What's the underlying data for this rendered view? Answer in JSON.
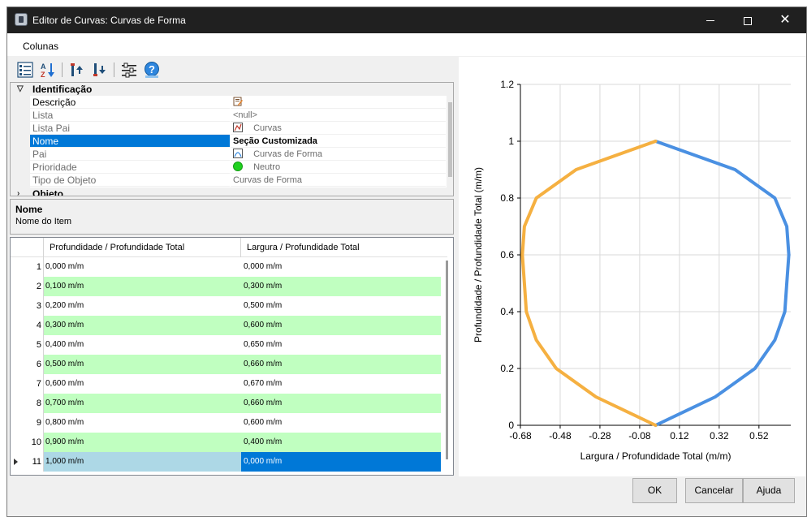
{
  "window": {
    "title": "Editor de Curvas: Curvas de Forma"
  },
  "menu": {
    "columns_label": "Colunas"
  },
  "toolbar": {
    "icons": [
      "categorized-view-icon",
      "sort-az-icon",
      "move-up-icon",
      "move-down-icon",
      "settings-sliders-icon",
      "help-icon"
    ]
  },
  "property_grid": {
    "category_identification": "Identificação",
    "category_object": "Objeto",
    "rows": [
      {
        "name": "Descrição",
        "value": "",
        "icon": "edit-description-icon",
        "readonly": false
      },
      {
        "name": "Lista",
        "value": "<null>",
        "icon": "",
        "readonly": true
      },
      {
        "name": "Lista Pai",
        "value": "Curvas",
        "icon": "curves-list-icon",
        "readonly": true
      },
      {
        "name": "Nome",
        "value": "Seção Customizada",
        "icon": "",
        "readonly": false,
        "selected": true
      },
      {
        "name": "Pai",
        "value": "Curvas de Forma",
        "icon": "shape-curves-icon",
        "readonly": true
      },
      {
        "name": "Prioridade",
        "value": "Neutro",
        "icon": "green-circle-icon",
        "readonly": true
      },
      {
        "name": "Tipo de Objeto",
        "value": "Curvas de Forma",
        "icon": "",
        "readonly": true
      }
    ]
  },
  "help_panel": {
    "title": "Nome",
    "description": "Nome do Item"
  },
  "table": {
    "columns": [
      "Profundidade / Profundidade Total",
      "Largura / Profundidade Total"
    ],
    "rows": [
      {
        "index": "1",
        "depth": "0,000 m/m",
        "width": "0,000 m/m"
      },
      {
        "index": "2",
        "depth": "0,100 m/m",
        "width": "0,300 m/m"
      },
      {
        "index": "3",
        "depth": "0,200 m/m",
        "width": "0,500 m/m"
      },
      {
        "index": "4",
        "depth": "0,300 m/m",
        "width": "0,600 m/m"
      },
      {
        "index": "5",
        "depth": "0,400 m/m",
        "width": "0,650 m/m"
      },
      {
        "index": "6",
        "depth": "0,500 m/m",
        "width": "0,660 m/m"
      },
      {
        "index": "7",
        "depth": "0,600 m/m",
        "width": "0,670 m/m"
      },
      {
        "index": "8",
        "depth": "0,700 m/m",
        "width": "0,660 m/m"
      },
      {
        "index": "9",
        "depth": "0,800 m/m",
        "width": "0,600 m/m"
      },
      {
        "index": "10",
        "depth": "0,900 m/m",
        "width": "0,400 m/m"
      },
      {
        "index": "11",
        "depth": "1,000 m/m",
        "width": "0,000 m/m"
      }
    ]
  },
  "chart_data": {
    "type": "line",
    "title": "",
    "xlabel": "Largura / Profundidade Total (m/m)",
    "ylabel": "Profundidade / Profundidade Total (m/m)",
    "xlim": [
      -0.68,
      0.68
    ],
    "ylim": [
      0,
      1.2
    ],
    "x_ticks": [
      "-0.68",
      "-0.48",
      "-0.28",
      "-0.08",
      "0.12",
      "0.32",
      "0.52"
    ],
    "x_tick_values": [
      -0.68,
      -0.48,
      -0.28,
      -0.08,
      0.12,
      0.32,
      0.52
    ],
    "y_ticks": [
      "0",
      "0.2",
      "0.4",
      "0.6",
      "0.8",
      "1",
      "1.2"
    ],
    "y_tick_values": [
      0,
      0.2,
      0.4,
      0.6,
      0.8,
      1.0,
      1.2
    ],
    "grid": true,
    "series": [
      {
        "color": "#4a90e2",
        "x": [
          0,
          0.3,
          0.5,
          0.6,
          0.65,
          0.66,
          0.67,
          0.66,
          0.6,
          0.4,
          0
        ],
        "y": [
          0,
          0.1,
          0.2,
          0.3,
          0.4,
          0.5,
          0.6,
          0.7,
          0.8,
          0.9,
          1.0
        ]
      },
      {
        "color": "#f5b041",
        "x": [
          0,
          -0.3,
          -0.5,
          -0.6,
          -0.65,
          -0.66,
          -0.67,
          -0.66,
          -0.6,
          -0.4,
          0
        ],
        "y": [
          0,
          0.1,
          0.2,
          0.3,
          0.4,
          0.5,
          0.6,
          0.7,
          0.8,
          0.9,
          1.0
        ]
      }
    ]
  },
  "footer": {
    "ok": "OK",
    "cancel": "Cancelar",
    "help": "Ajuda"
  }
}
